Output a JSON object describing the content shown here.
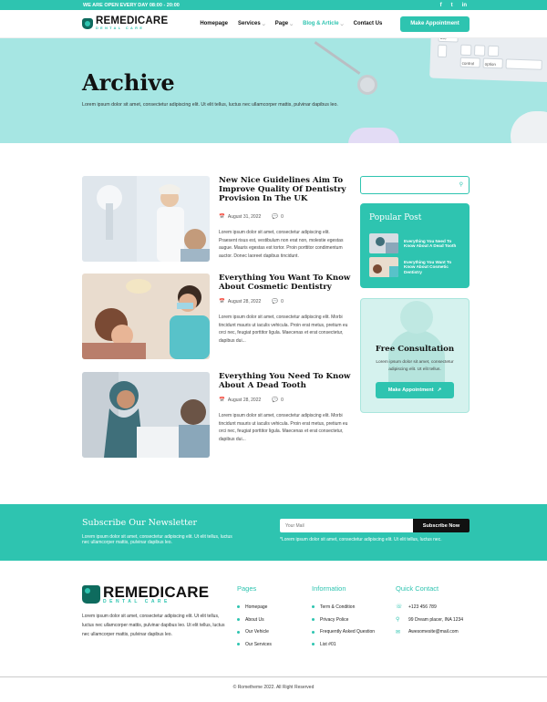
{
  "topbar": {
    "text": "WE ARE OPEN EVERY DAY  08:00 - 20:00",
    "social": [
      "f",
      "t",
      "in"
    ]
  },
  "logo": {
    "brand": "REMEDICARE",
    "sub": "DENTAL CARE"
  },
  "nav": {
    "items": [
      {
        "label": "Homepage"
      },
      {
        "label": "Services",
        "dropdown": true
      },
      {
        "label": "Page",
        "dropdown": true
      },
      {
        "label": "Blog & Article",
        "dropdown": true,
        "active": true
      },
      {
        "label": "Contact Us"
      }
    ],
    "cta": "Make Appointment"
  },
  "hero": {
    "title": "Archive",
    "text": "Lorem ipsum dolor sit amet, consectetur adipiscing elit. Ut elit tellus, luctus nec ullamcorper mattis, pulvinar dapibus leo.",
    "keys": [
      "use",
      "control",
      "option"
    ]
  },
  "posts": [
    {
      "title": "New Nice Guidelines Aim To Improve Quality Of Dentistry Provision In The UK",
      "date": "August 31, 2022",
      "comments": "0",
      "excerpt": "Lorem ipsum dolor sit amet, consectetur adipiscing elit. Praesent risus est, vestibulum non erat non, molestie egestas augue. Mauris egestas est tortor. Proin porttitor condimentum auctor. Donec laoreet dapibus tincidunt."
    },
    {
      "title": "Everything You Want To Know About Cosmetic Dentistry",
      "date": "August 28, 2022",
      "comments": "0",
      "excerpt": "Lorem ipsum dolor sit amet, consectetur adipiscing elit. Morbi tincidunt mauris ut iaculis vehicula. Proin erat metus, pretium eu orci nec, feugiat porttitor ligula. Maecenas et erat consectetur, dapibus dui..."
    },
    {
      "title": "Everything You Need To Know About A Dead Tooth",
      "date": "August 28, 2022",
      "comments": "0",
      "excerpt": "Lorem ipsum dolor sit amet, consectetur adipiscing elit. Morbi tincidunt mauris ut iaculis vehicula. Proin erat metus, pretium eu orci nec, feugiat porttitor ligula. Maecenas et erat consectetur, dapibus dui..."
    }
  ],
  "sidebar": {
    "search_placeholder": "",
    "popular_title": "Popular Post",
    "popular": [
      {
        "title": "Everything You Need To Know About A Dead Tooth"
      },
      {
        "title": "Everything You Want To Know About Cosmetic Dentistry"
      }
    ],
    "consult_title": "Free Consultation",
    "consult_text": "Lorem ipsum dolor sit amet, consectetur adipiscing elit. Ut elit tellus.",
    "consult_btn": "Make Appointment"
  },
  "newsletter": {
    "title": "Subscribe Our Newsletter",
    "text": "Lorem ipsum dolor sit amet, consectetur adipiscing elit. Ut elit tellus, luctus nec ullamcorper mattis, pulvinar dapibus leo.",
    "placeholder": "Your Mail",
    "button": "Subscribe Now",
    "note": "*Lorem ipsum dolor sit amet, consectetur adipiscing elit. Ut elit tellus, luctus nec."
  },
  "footer": {
    "desc": "Lorem ipsum dolor sit amet, consectetur adipiscing elit. Ut elit tellus, luctus nec ullamcorper mattis, pulvinar dapibus leo. Ut elit tellus, luctus nec ullamcorper mattis, pulvinar dapibus leo.",
    "pages_title": "Pages",
    "pages": [
      "Homepage",
      "About Us",
      "Our Vehicle",
      "Our Services"
    ],
    "info_title": "Information",
    "info": [
      "Term & Condition",
      "Privacy Police",
      "Frequently Asked Question",
      "List #01"
    ],
    "contact_title": "Quick Contact",
    "contact": [
      {
        "icon": "phone-icon",
        "text": "+123 456 789"
      },
      {
        "icon": "location-icon",
        "text": "99 Dream placer, INA 1234"
      },
      {
        "icon": "mail-icon",
        "text": "Awesomesite@mail.com"
      }
    ],
    "copyright": "© Rometheme 2022. All Right Reserved"
  }
}
